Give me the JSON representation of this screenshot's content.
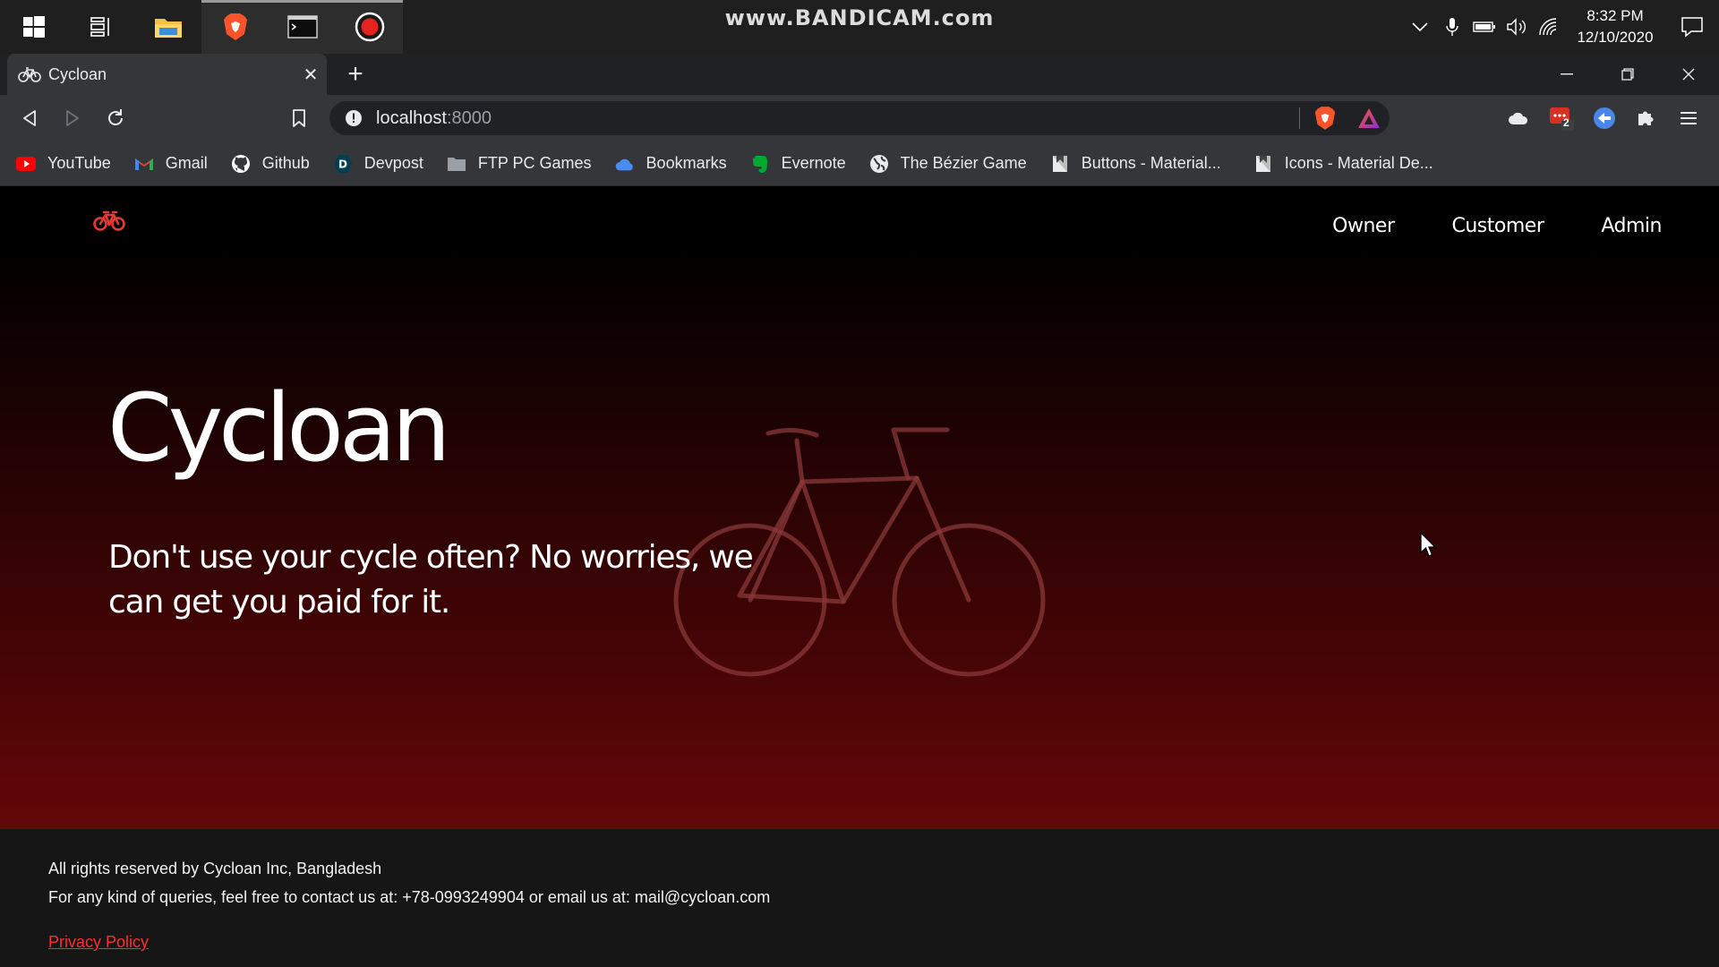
{
  "taskbar": {
    "watermark": "www.BANDICAM.com",
    "time": "8:32 PM",
    "date": "12/10/2020"
  },
  "browser": {
    "tab_title": "Cycloan",
    "url_host": "localhost",
    "url_port": ":8000",
    "bookmarks": [
      {
        "label": "YouTube",
        "icon": "youtube-icon"
      },
      {
        "label": "Gmail",
        "icon": "gmail-icon"
      },
      {
        "label": "Github",
        "icon": "github-icon"
      },
      {
        "label": "Devpost",
        "icon": "devpost-icon"
      },
      {
        "label": "FTP PC Games",
        "icon": "folder-icon"
      },
      {
        "label": "Bookmarks",
        "icon": "cloud-icon"
      },
      {
        "label": "Evernote",
        "icon": "evernote-icon"
      },
      {
        "label": "The Bézier Game",
        "icon": "globe-icon"
      },
      {
        "label": "Buttons - Material...",
        "icon": "material-icon"
      },
      {
        "label": "Icons - Material De...",
        "icon": "material-icon"
      }
    ],
    "extension_badge": "2"
  },
  "site": {
    "nav": [
      "Owner",
      "Customer",
      "Admin"
    ],
    "hero_title": "Cycloan",
    "hero_subtitle": "Don't use your cycle often? No worries, we can get you paid for it.",
    "footer_line1": "All rights reserved by Cycloan Inc, Bangladesh",
    "footer_line2": "For any kind of queries, feel free to contact us at: +78-0993249904 or email us at: mail@cycloan.com",
    "privacy_link": "Privacy Policy"
  },
  "colors": {
    "accent": "#e53935",
    "page_bottom": "#760909",
    "link": "#ff2d2d"
  }
}
